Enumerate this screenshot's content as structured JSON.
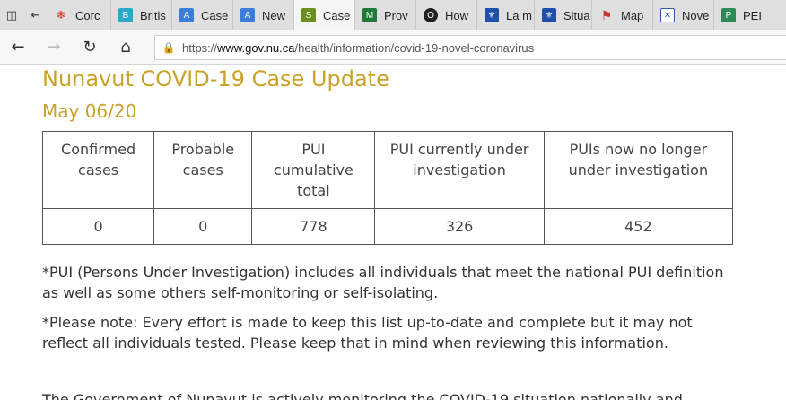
{
  "browser": {
    "tabs": [
      {
        "label": "Corc",
        "icon": "maple-leaf-icon",
        "color": "#d52b1e"
      },
      {
        "label": "Britis",
        "icon": "bc-shield-icon",
        "color": "#2fa8c8"
      },
      {
        "label": "Case",
        "icon": "alberta-icon",
        "color": "#3b7dd8"
      },
      {
        "label": "New",
        "icon": "alberta-icon",
        "color": "#3b7dd8"
      },
      {
        "label": "Case",
        "icon": "sask-icon",
        "color": "#6b8e23"
      },
      {
        "label": "Prov",
        "icon": "manitoba-icon",
        "color": "#1f7a3a"
      },
      {
        "label": "How",
        "icon": "ontario-icon",
        "color": "#222222"
      },
      {
        "label": "La m",
        "icon": "quebec-icon",
        "color": "#1f4fa8"
      },
      {
        "label": "Situa",
        "icon": "quebec-icon",
        "color": "#1f4fa8"
      },
      {
        "label": "Map",
        "icon": "map-icon",
        "color": "#c0392b"
      },
      {
        "label": "Nove",
        "icon": "ns-flag-icon",
        "color": "#2f5da8"
      },
      {
        "label": "PEI",
        "icon": "pei-icon",
        "color": "#2e8b57"
      }
    ],
    "address": {
      "prefix": "https://",
      "host": "www.gov.nu.ca",
      "path": "/health/information/covid-19-novel-coronavirus"
    }
  },
  "page": {
    "title": "Nunavut COVID-19 Case Update",
    "date": "May 06/20",
    "table": {
      "headers": [
        "Confirmed cases",
        "Probable cases",
        "PUI cumulative total",
        "PUI currently under investigation",
        "PUIs now no longer under investigation"
      ],
      "rows": [
        [
          "0",
          "0",
          "778",
          "326",
          "452"
        ]
      ]
    },
    "note1": "*PUI (Persons Under Investigation) includes all individuals that meet the national PUI definition as well as some others self-monitoring or self-isolating.",
    "note2": "*Please note: Every effort is made to keep this list up-to-date and complete but it may not reflect all individuals tested. Please keep that in mind when reviewing this information.",
    "cutoff_text": "The Government of Nunavut is actively monitoring the COVID-19 situation nationally and",
    "accent_color": "#c9a227"
  }
}
